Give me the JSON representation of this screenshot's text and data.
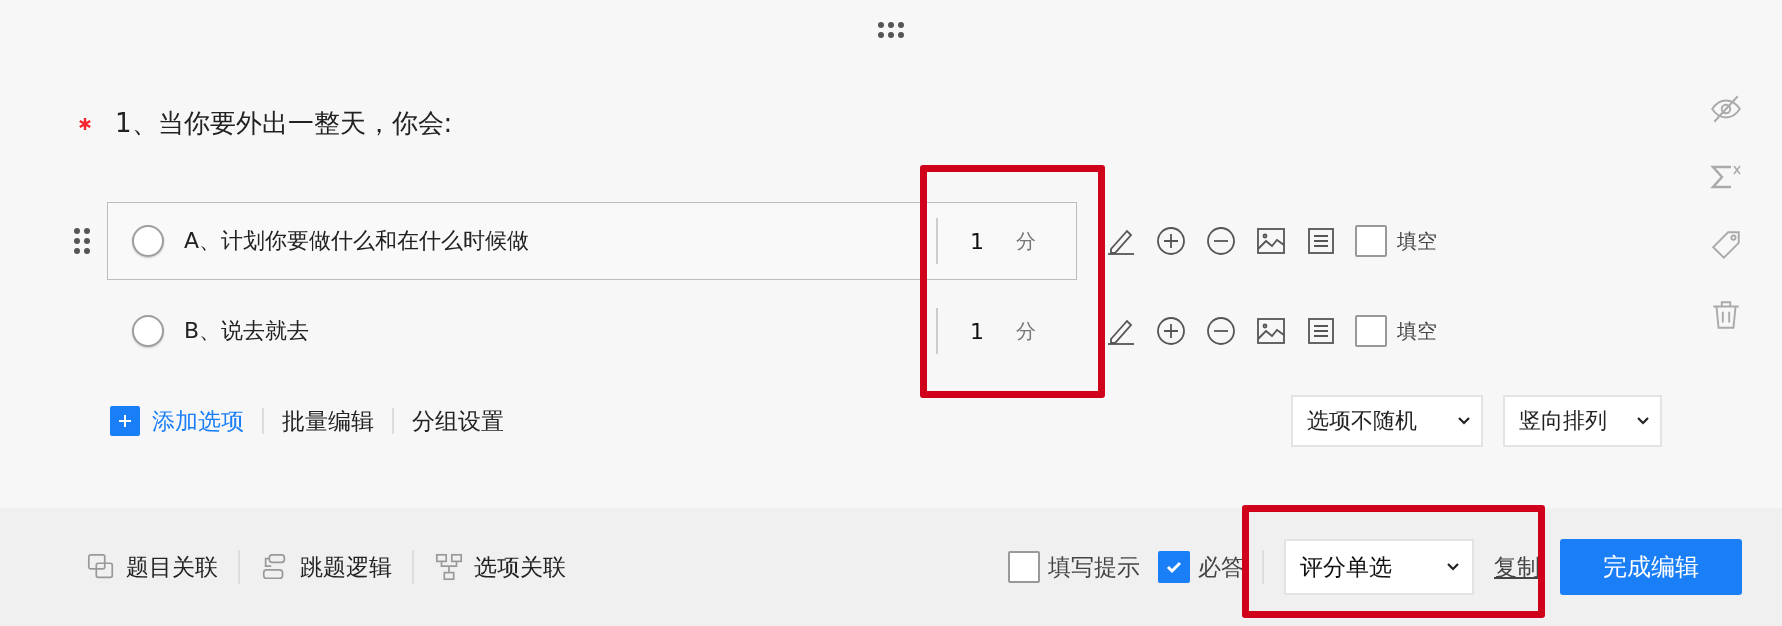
{
  "question": {
    "title": "1、当你要外出一整天，你会:",
    "required": true
  },
  "options": [
    {
      "label": "A、计划你要做什么和在什么时候做",
      "score": "1",
      "unit": "分",
      "selected": true,
      "fill_blank": {
        "label": "填空",
        "checked": false
      }
    },
    {
      "label": "B、说去就去",
      "score": "1",
      "unit": "分",
      "selected": false,
      "fill_blank": {
        "label": "填空",
        "checked": false
      }
    }
  ],
  "option_actions": [
    {
      "label": "添加选项",
      "kind": "add"
    },
    {
      "label": "批量编辑",
      "kind": "link"
    },
    {
      "label": "分组设置",
      "kind": "link"
    }
  ],
  "selects": [
    {
      "value": "选项不随机"
    },
    {
      "value": "竖向排列"
    }
  ],
  "footer": {
    "links": [
      {
        "label": "题目关联",
        "kind": "relation"
      },
      {
        "label": "跳题逻辑",
        "kind": "jump"
      },
      {
        "label": "选项关联",
        "kind": "option"
      }
    ],
    "hint_checkbox": {
      "label": "填写提示",
      "checked": false
    },
    "required_checkbox": {
      "label": "必答",
      "checked": true
    },
    "type_select": {
      "value": "评分单选"
    },
    "copy_link": "复制",
    "done_button": "完成编辑"
  },
  "annotations": [
    {
      "kind": "highlight"
    },
    {
      "kind": "highlight"
    }
  ]
}
